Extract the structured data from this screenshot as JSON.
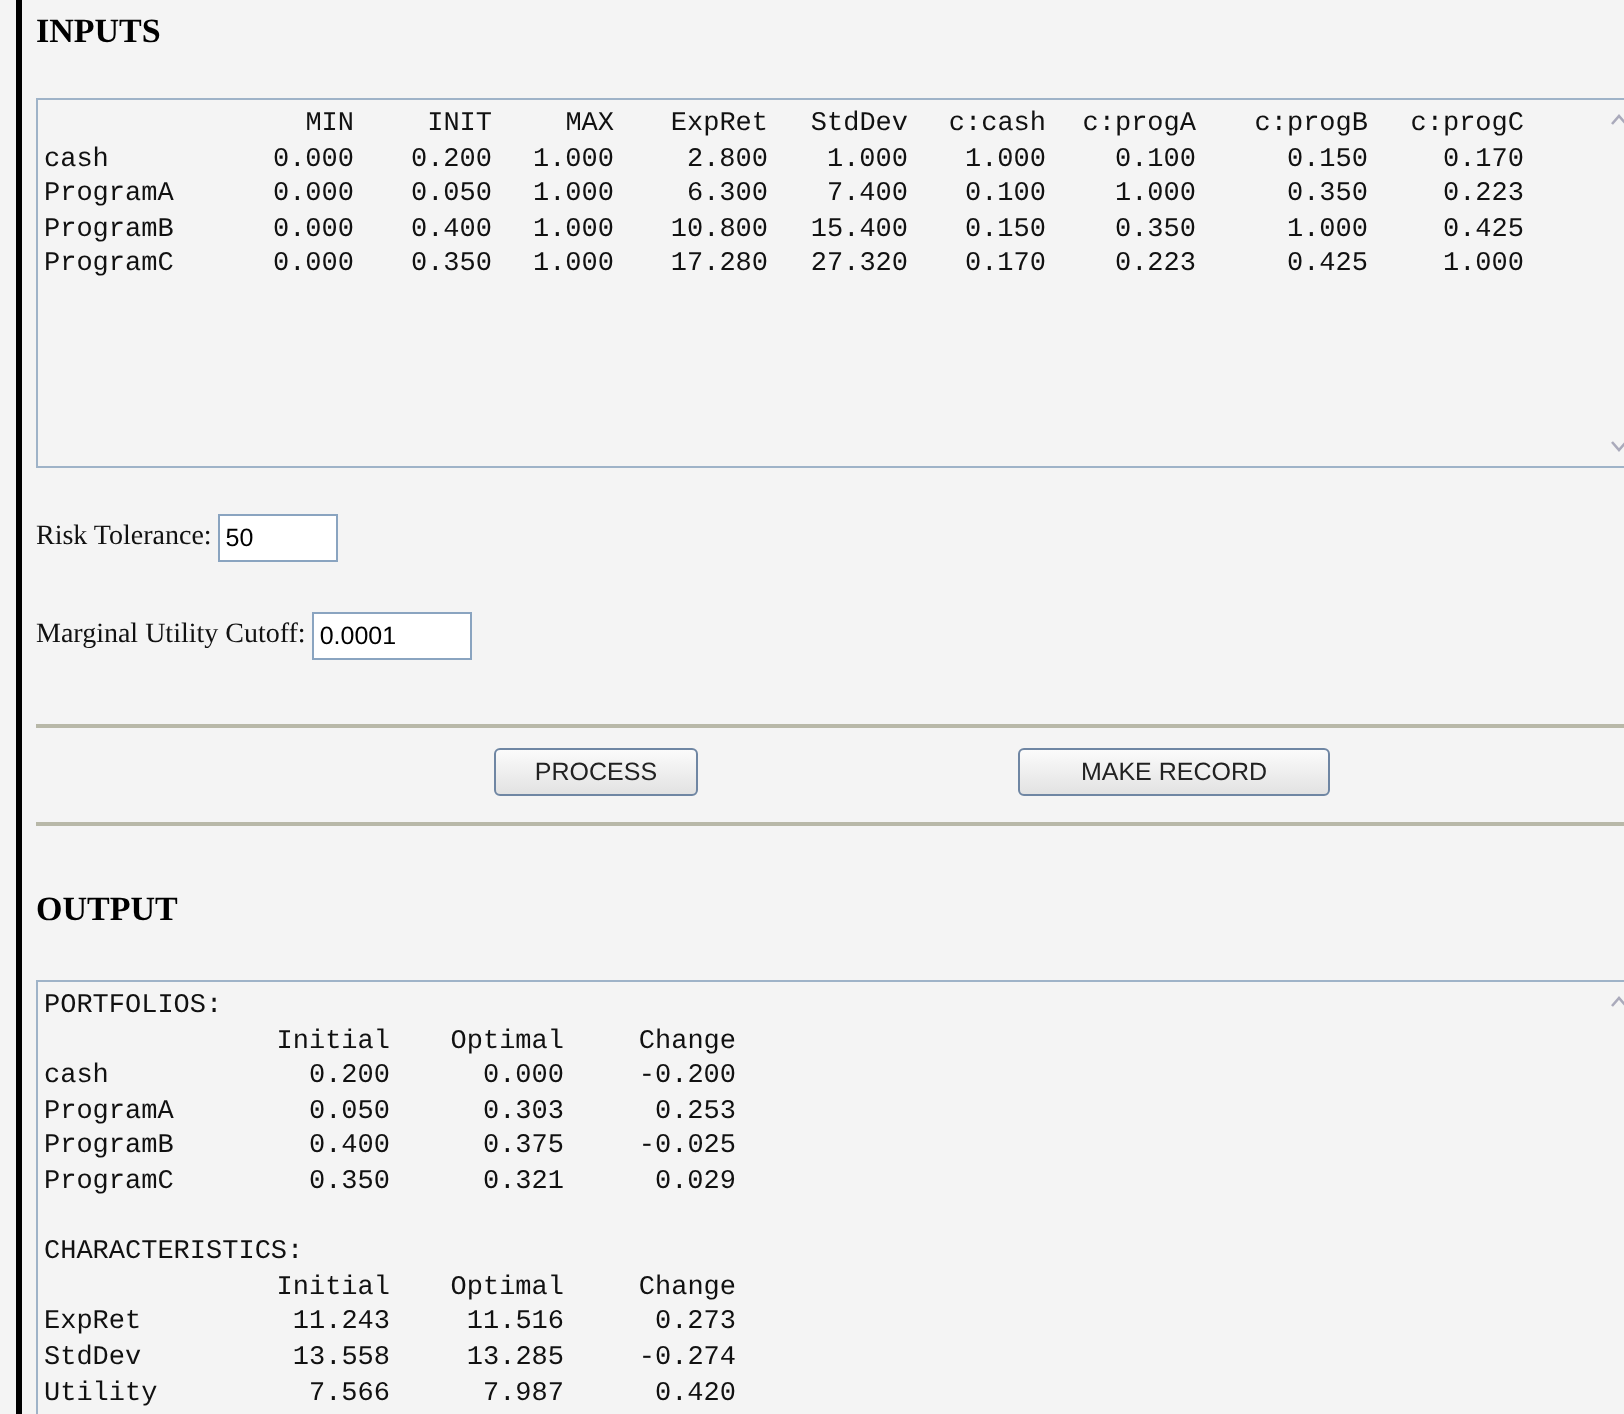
{
  "inputs": {
    "heading": "INPUTS",
    "columns": [
      "MIN",
      "INIT",
      "MAX",
      "ExpRet",
      "StdDev",
      "c:cash",
      "c:progA",
      "c:progB",
      "c:progC"
    ],
    "rows": [
      {
        "name": "cash",
        "values": [
          "0.000",
          "0.200",
          "1.000",
          "2.800",
          "1.000",
          "1.000",
          "0.100",
          "0.150",
          "0.170"
        ]
      },
      {
        "name": "ProgramA",
        "values": [
          "0.000",
          "0.050",
          "1.000",
          "6.300",
          "7.400",
          "0.100",
          "1.000",
          "0.350",
          "0.223"
        ]
      },
      {
        "name": "ProgramB",
        "values": [
          "0.000",
          "0.400",
          "1.000",
          "10.800",
          "15.400",
          "0.150",
          "0.350",
          "1.000",
          "0.425"
        ]
      },
      {
        "name": "ProgramC",
        "values": [
          "0.000",
          "0.350",
          "1.000",
          "17.280",
          "27.320",
          "0.170",
          "0.223",
          "0.425",
          "1.000"
        ]
      }
    ]
  },
  "fields": [
    {
      "label": "Risk Tolerance:",
      "value": "50"
    },
    {
      "label": "Marginal Utility Cutoff:",
      "value": "0.0001"
    }
  ],
  "buttons": [
    "PROCESS",
    "MAKE RECORD"
  ],
  "output": {
    "heading": "OUTPUT",
    "sections": [
      {
        "title": "PORTFOLIOS:",
        "columns": [
          "Initial",
          "Optimal",
          "Change"
        ],
        "rows": [
          {
            "name": "cash",
            "values": [
              "0.200",
              "0.000",
              "-0.200"
            ]
          },
          {
            "name": "ProgramA",
            "values": [
              "0.050",
              "0.303",
              "0.253"
            ]
          },
          {
            "name": "ProgramB",
            "values": [
              "0.400",
              "0.375",
              "-0.025"
            ]
          },
          {
            "name": "ProgramC",
            "values": [
              "0.350",
              "0.321",
              "0.029"
            ]
          }
        ]
      },
      {
        "title": "CHARACTERISTICS:",
        "columns": [
          "Initial",
          "Optimal",
          "Change"
        ],
        "rows": [
          {
            "name": "ExpRet",
            "values": [
              "11.243",
              "11.516",
              "0.273"
            ]
          },
          {
            "name": "StdDev",
            "values": [
              "13.558",
              "13.285",
              "-0.274"
            ]
          },
          {
            "name": "Utility",
            "values": [
              "7.566",
              "7.987",
              "0.420"
            ]
          }
        ]
      }
    ]
  }
}
